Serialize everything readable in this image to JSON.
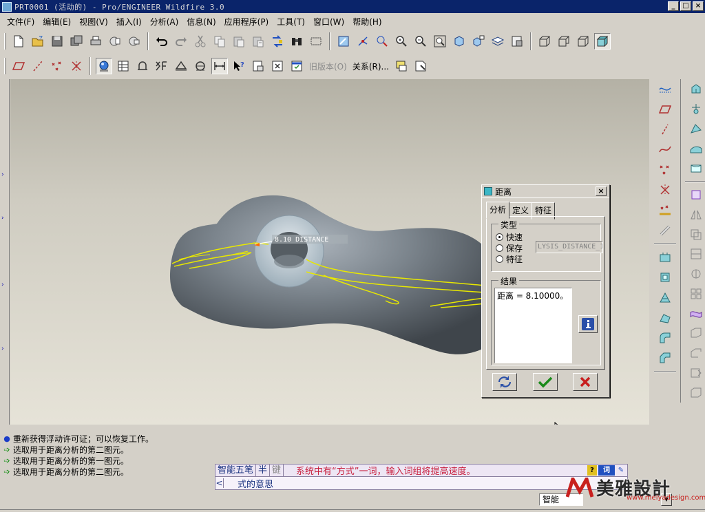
{
  "window": {
    "title": "PRT0001 (活动的) - Pro/ENGINEER Wildfire 3.0",
    "controls": [
      "_",
      "□",
      "×"
    ]
  },
  "menu": [
    {
      "label": "文件(F)"
    },
    {
      "label": "编辑(E)"
    },
    {
      "label": "视图(V)"
    },
    {
      "label": "插入(I)"
    },
    {
      "label": "分析(A)"
    },
    {
      "label": "信息(N)"
    },
    {
      "label": "应用程序(P)"
    },
    {
      "label": "工具(T)"
    },
    {
      "label": "窗口(W)"
    },
    {
      "label": "帮助(H)"
    }
  ],
  "toolbar2": {
    "version_label": "旧版本(O)",
    "relations_label": "关系(R)..."
  },
  "model": {
    "dimension_label": "8.10  DISTANCE",
    "accent_curve": "#e8e800",
    "body_dark": "#4a5056",
    "body_light": "#a7b0b8"
  },
  "dialog": {
    "title": "距离",
    "tabs": [
      "分析",
      "定义",
      "特征"
    ],
    "type_group_label": "类型",
    "type_options": [
      "快速",
      "保存",
      "特征"
    ],
    "type_selected": "快速",
    "analysis_name": "LYSIS_DISTANCE_1",
    "result_group_label": "结果",
    "result_text": "距离 = 8.10000。"
  },
  "messages": [
    {
      "icon": "info-dot",
      "text": "重新获得浮动许可证；可以恢复工作。"
    },
    {
      "icon": "arrow",
      "text": "选取用于距离分析的第二图元。"
    },
    {
      "icon": "arrow",
      "text": "选取用于距离分析的第一图元。"
    },
    {
      "icon": "arrow",
      "text": "选取用于距离分析的第二图元。"
    }
  ],
  "ime": {
    "name": "智能五笔",
    "mode": "半",
    "key": "键",
    "hint": "系统中有“方式”一词，输入词组将提高速度。",
    "candidate_arrow": "<",
    "candidate": "式的意思",
    "tools": [
      "?",
      "词"
    ]
  },
  "statusbar": {
    "filter": "智能"
  },
  "watermark": {
    "brand": "美雅設計",
    "url": "www.meiyadesign.com"
  }
}
